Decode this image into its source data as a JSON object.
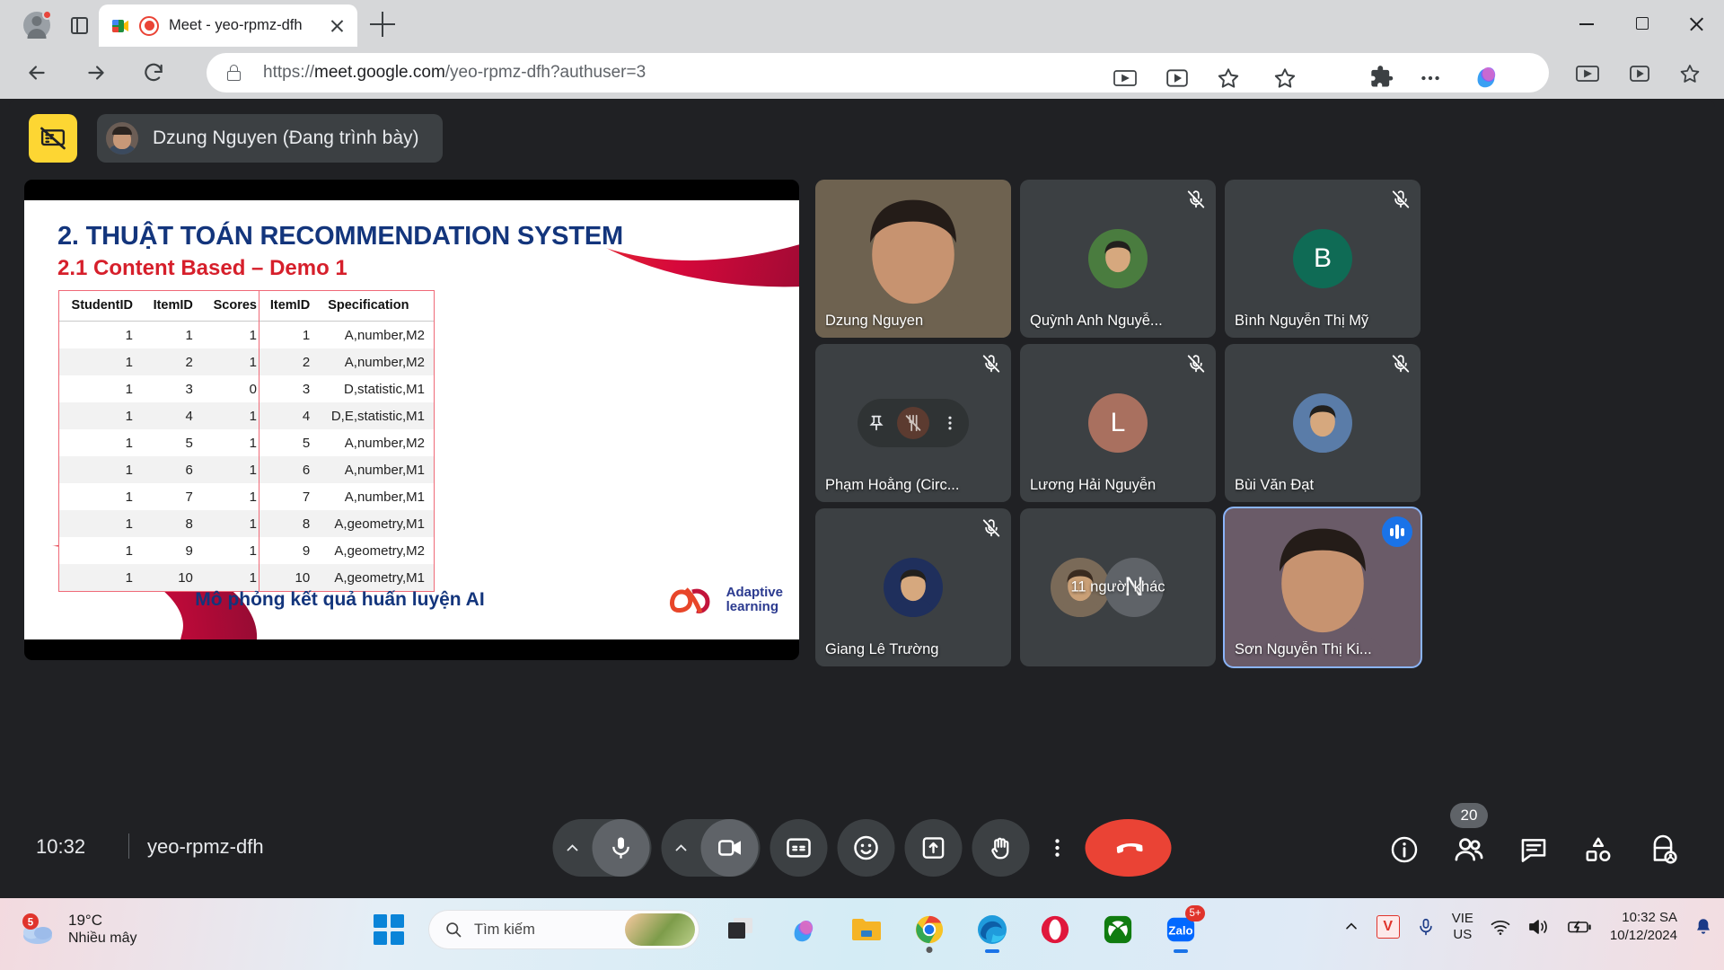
{
  "browser": {
    "tab_title": "Meet - yeo-rpmz-dfh",
    "url_prefix": "https://",
    "url_domain": "meet.google.com",
    "url_path": "/yeo-rpmz-dfh?authuser=3",
    "icons": {
      "profile": "profile-avatar-icon",
      "tab_search": "tab-search-icon",
      "recording": "recording-indicator-icon",
      "back": "back-arrow-icon",
      "forward": "forward-arrow-icon",
      "reload": "reload-icon",
      "lock": "lock-icon",
      "cast": "cast-icon",
      "media": "media-control-icon",
      "bookmark": "star-icon",
      "extensions": "extensions-puzzle-icon",
      "more": "three-dots-menu-icon",
      "copilot": "copilot-icon",
      "minimize": "minimize-icon",
      "maximize": "maximize-icon",
      "close": "close-icon"
    }
  },
  "meet": {
    "presenting_banner": {
      "stop_present_label": "stop-presenting",
      "presenter_name": "Dzung Nguyen (Đang trình bày)"
    },
    "slide": {
      "title": "2. THUẬT TOÁN RECOMMENDATION SYSTEM",
      "subtitle": "2.1 Content Based – Demo 1",
      "caption": "Mô phỏng kết quả huấn luyện AI",
      "logo_line1": "Adaptive",
      "logo_line2": "learning",
      "table_scores": {
        "headers": [
          "StudentID",
          "ItemID",
          "Scores"
        ],
        "rows": [
          [
            "1",
            "1",
            "1"
          ],
          [
            "1",
            "2",
            "1"
          ],
          [
            "1",
            "3",
            "0"
          ],
          [
            "1",
            "4",
            "1"
          ],
          [
            "1",
            "5",
            "1"
          ],
          [
            "1",
            "6",
            "1"
          ],
          [
            "1",
            "7",
            "1"
          ],
          [
            "1",
            "8",
            "1"
          ],
          [
            "1",
            "9",
            "1"
          ],
          [
            "1",
            "10",
            "1"
          ]
        ]
      },
      "table_items": {
        "headers": [
          "ItemID",
          "Specification"
        ],
        "rows": [
          [
            "1",
            "A,number,M2"
          ],
          [
            "2",
            "A,number,M2"
          ],
          [
            "3",
            "D,statistic,M1"
          ],
          [
            "4",
            "D,E,statistic,M1"
          ],
          [
            "5",
            "A,number,M2"
          ],
          [
            "6",
            "A,number,M1"
          ],
          [
            "7",
            "A,number,M1"
          ],
          [
            "8",
            "A,geometry,M1"
          ],
          [
            "9",
            "A,geometry,M2"
          ],
          [
            "10",
            "A,geometry,M1"
          ]
        ]
      }
    },
    "participants": [
      {
        "name": "Dzung Nguyen",
        "type": "video",
        "muted": false,
        "active": false,
        "accent": "#6e6250"
      },
      {
        "name": "Quỳnh Anh Nguyễ...",
        "type": "photo",
        "muted": true,
        "active": false,
        "accent": "#4a7c3f"
      },
      {
        "name": "Bình Nguyễn Thị Mỹ",
        "type": "initial",
        "initial": "B",
        "muted": true,
        "active": false,
        "accent": "#0f6b55"
      },
      {
        "name": "Phạm Hoằng (Circ...",
        "type": "hover",
        "muted": true,
        "active": false,
        "accent": "#3c4043"
      },
      {
        "name": "Lương Hải Nguyễn",
        "type": "initial",
        "initial": "L",
        "muted": true,
        "active": false,
        "accent": "#a9705f"
      },
      {
        "name": "Bùi Văn Đạt",
        "type": "photo",
        "muted": true,
        "active": false,
        "accent": "#5a7ca8"
      },
      {
        "name": "Giang Lê Trường",
        "type": "photo",
        "muted": true,
        "active": false,
        "accent": "#1f2f5c"
      },
      {
        "name": "11 người khác",
        "type": "overflow",
        "initial": "N",
        "muted": false,
        "active": false,
        "accent": "#7a6a58"
      },
      {
        "name": "Sơn Nguyễn Thị Ki...",
        "type": "video",
        "muted": false,
        "active": true,
        "accent": "#6a5b68"
      }
    ],
    "hover_controls": {
      "pin": "pin-icon",
      "block": "block-video-icon",
      "more": "more-options-icon"
    },
    "bottom_bar": {
      "time": "10:32",
      "meeting_code": "yeo-rpmz-dfh",
      "controls": [
        {
          "name": "mic-options-chevron",
          "icon": "chevron-up-icon"
        },
        {
          "name": "microphone-button",
          "icon": "microphone-icon"
        },
        {
          "name": "camera-options-chevron",
          "icon": "chevron-up-icon"
        },
        {
          "name": "camera-button",
          "icon": "camera-icon"
        },
        {
          "name": "captions-button",
          "icon": "cc-icon"
        },
        {
          "name": "reactions-button",
          "icon": "emoji-icon"
        },
        {
          "name": "present-button",
          "icon": "present-screen-icon"
        },
        {
          "name": "raise-hand-button",
          "icon": "hand-icon"
        },
        {
          "name": "more-options-button",
          "icon": "three-dots-icon"
        },
        {
          "name": "leave-call-button",
          "icon": "end-call-icon"
        }
      ],
      "right_controls": [
        {
          "name": "meeting-details-button",
          "icon": "info-icon",
          "badge": ""
        },
        {
          "name": "people-button",
          "icon": "people-icon",
          "badge": "20"
        },
        {
          "name": "chat-button",
          "icon": "chat-icon",
          "badge": ""
        },
        {
          "name": "activities-button",
          "icon": "activities-icon",
          "badge": ""
        },
        {
          "name": "host-controls-button",
          "icon": "host-lock-icon",
          "badge": ""
        }
      ]
    }
  },
  "taskbar": {
    "weather": {
      "temperature": "19°C",
      "description": "Nhiều mây",
      "badge": "5"
    },
    "search_placeholder": "Tìm kiếm",
    "apps": [
      {
        "name": "start-button",
        "icon": "windows-logo-icon"
      },
      {
        "name": "task-view-button",
        "icon": "task-view-icon"
      },
      {
        "name": "copilot-button",
        "icon": "copilot-icon"
      },
      {
        "name": "file-explorer-button",
        "icon": "folder-icon"
      },
      {
        "name": "chrome-button",
        "icon": "chrome-icon"
      },
      {
        "name": "edge-button",
        "icon": "edge-icon"
      },
      {
        "name": "opera-button",
        "icon": "opera-icon"
      },
      {
        "name": "xbox-button",
        "icon": "xbox-icon"
      },
      {
        "name": "zalo-button",
        "icon": "zalo-icon",
        "badge": "5+"
      }
    ],
    "tray": {
      "overflow": "show-hidden-icons",
      "unikey": "V",
      "mic": "microphone-icon",
      "lang_line1": "VIE",
      "lang_line2": "US",
      "wifi": "wifi-icon",
      "volume": "volume-icon",
      "battery": "battery-charging-icon",
      "time": "10:32 SA",
      "date": "10/12/2024",
      "notification": "notification-bell-icon"
    }
  }
}
